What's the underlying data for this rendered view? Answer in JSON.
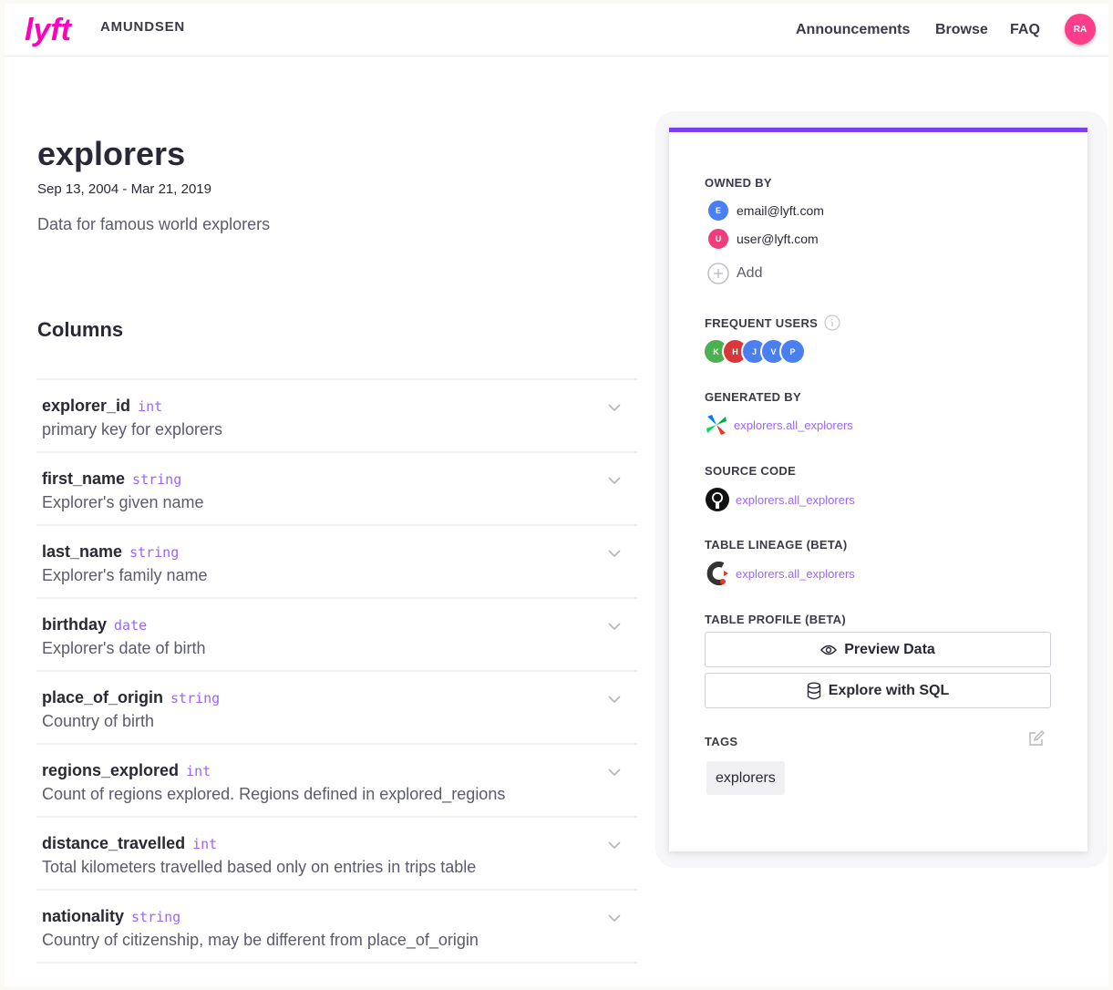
{
  "header": {
    "logo_text": "lyft",
    "brand": "AMUNDSEN",
    "nav": [
      "Announcements",
      "Browse",
      "FAQ"
    ],
    "avatar_initials": "RA",
    "accent_color": "#ff00bf"
  },
  "table": {
    "title": "explorers",
    "date_range": "Sep 13, 2004 - Mar 21, 2019",
    "description": "Data for famous world explorers"
  },
  "columns_section": {
    "title": "Columns",
    "columns": [
      {
        "name": "explorer_id",
        "type": "int",
        "description": "primary key for explorers"
      },
      {
        "name": "first_name",
        "type": "string",
        "description": "Explorer's given name"
      },
      {
        "name": "last_name",
        "type": "string",
        "description": "Explorer's family name"
      },
      {
        "name": "birthday",
        "type": "date",
        "description": "Explorer's date of birth"
      },
      {
        "name": "place_of_origin",
        "type": "string",
        "description": "Country of birth"
      },
      {
        "name": "regions_explored",
        "type": "int",
        "description": "Count of regions explored. Regions defined in explored_regions"
      },
      {
        "name": "distance_travelled",
        "type": "int",
        "description": "Total kilometers travelled based only on entries in trips table"
      },
      {
        "name": "nationality",
        "type": "string",
        "description": "Country of citizenship, may be different from place_of_origin"
      }
    ]
  },
  "sidebar": {
    "owned_by_label": "OWNED BY",
    "owners": [
      {
        "initial": "E",
        "email": "email@lyft.com",
        "color": "#4a7ff2"
      },
      {
        "initial": "U",
        "email": "user@lyft.com",
        "color": "#f23d7a"
      }
    ],
    "add_label": "Add",
    "frequent_users_label": "FREQUENT USERS",
    "frequent_users": [
      {
        "initial": "K",
        "color": "#4caf50"
      },
      {
        "initial": "H",
        "color": "#d9383a"
      },
      {
        "initial": "J",
        "color": "#4a7ff2"
      },
      {
        "initial": "V",
        "color": "#4a7ff2"
      },
      {
        "initial": "P",
        "color": "#4a7ff2"
      }
    ],
    "generated_by_label": "GENERATED BY",
    "generated_by_link": "explorers.all_explorers",
    "source_code_label": "SOURCE CODE",
    "source_code_link": "explorers.all_explorers",
    "lineage_label": "TABLE LINEAGE (BETA)",
    "lineage_link": "explorers.all_explorers",
    "profile_label": "TABLE PROFILE (BETA)",
    "preview_button": "Preview Data",
    "sql_button": "Explore with SQL",
    "tags_label": "TAGS",
    "tags": [
      "explorers"
    ],
    "panel_accent": "#7b3ff0",
    "link_color": "#9c64ff"
  }
}
